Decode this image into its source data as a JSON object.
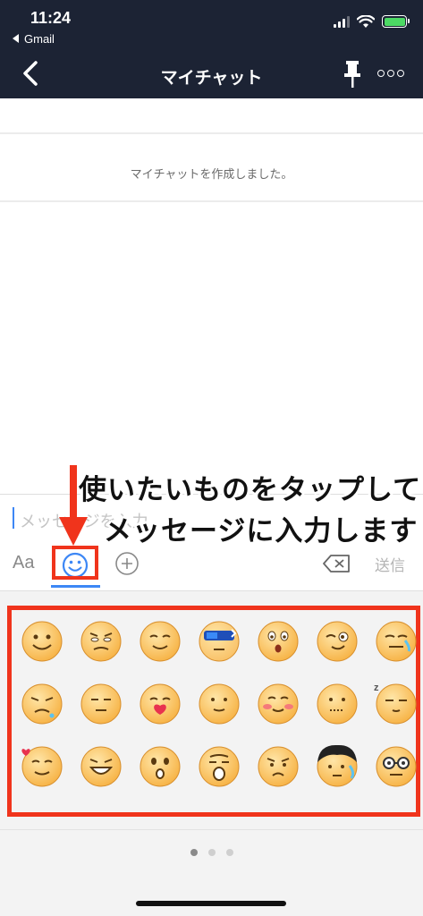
{
  "status_bar": {
    "time": "11:24",
    "back_app": "Gmail"
  },
  "nav": {
    "title": "マイチャット"
  },
  "chat": {
    "system_message": "マイチャットを作成しました。"
  },
  "input": {
    "placeholder": "メッセージを入力"
  },
  "toolbar": {
    "text_mode_label": "Aa",
    "send_label": "送信"
  },
  "emoji_panel": {
    "rows": [
      [
        "smile",
        "worried",
        "content",
        "cool-sunglasses",
        "surprised",
        "wink",
        "crying"
      ],
      [
        "sad-tear",
        "neutral",
        "kiss",
        "calm",
        "blush",
        "speechless",
        "sleepy"
      ],
      [
        "love",
        "grin",
        "shocked",
        "gasp",
        "frown",
        "sweat-hair",
        "nerd-glasses"
      ]
    ],
    "pages": 3,
    "current_page": 1
  },
  "annotation": {
    "line1": "使いたいものをタップして",
    "line2": "メッセージに入力します"
  },
  "colors": {
    "header_bg": "#1c2334",
    "accent_blue": "#3d87f5",
    "annotation_red": "#f0341c",
    "emoji_face": "#f7b54a"
  }
}
